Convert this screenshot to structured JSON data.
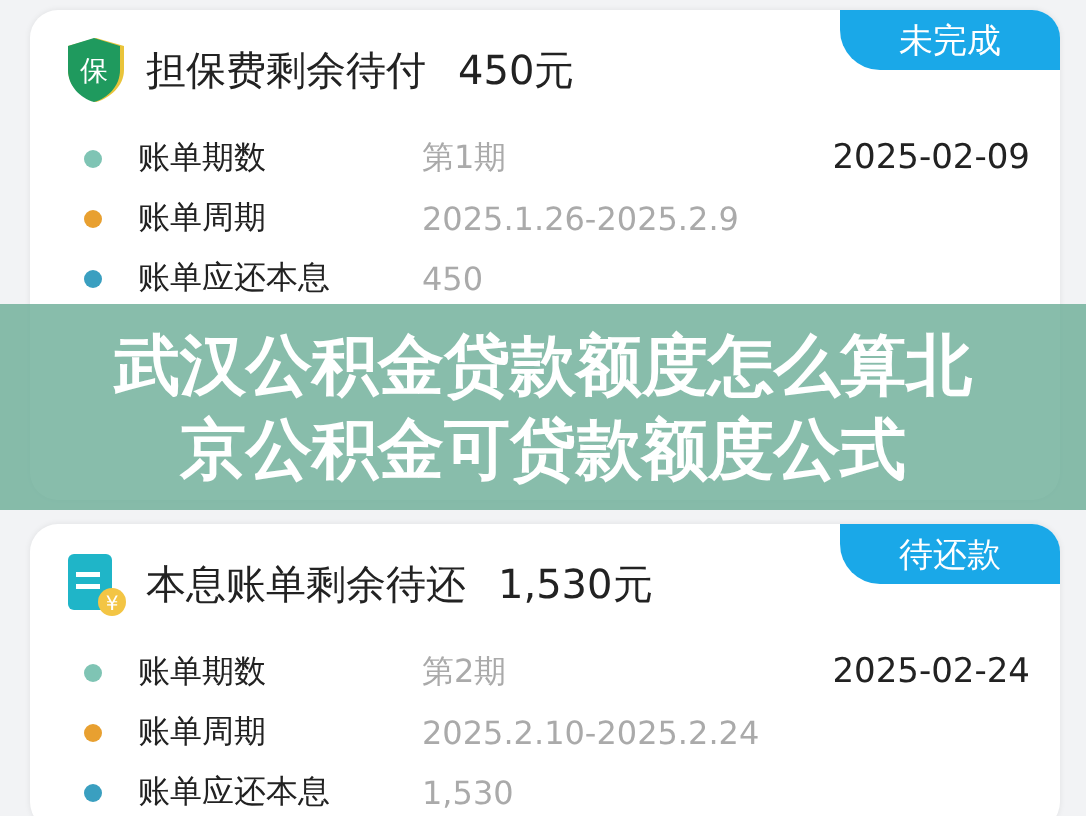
{
  "cards": [
    {
      "kind": "shield",
      "icon_text": "保",
      "title": "担保费剩余待付",
      "amount": "450元",
      "status": "未完成",
      "rows": [
        {
          "label": "账单期数",
          "value": "第1期",
          "date": "2025-02-09",
          "color": "#7fc4b4"
        },
        {
          "label": "账单周期",
          "value": "2025.1.26-2025.2.9",
          "color": "#e8a030"
        },
        {
          "label": "账单应还本息",
          "value": "450",
          "color": "#3a9fc0"
        }
      ]
    },
    {
      "kind": "bill",
      "icon_text": "¥",
      "title": "本息账单剩余待还",
      "amount": "1,530元",
      "status": "待还款",
      "rows": [
        {
          "label": "账单期数",
          "value": "第2期",
          "date": "2025-02-24",
          "color": "#7fc4b4"
        },
        {
          "label": "账单周期",
          "value": "2025.2.10-2025.2.24",
          "color": "#e8a030"
        },
        {
          "label": "账单应还本息",
          "value": "1,530",
          "color": "#3a9fc0"
        }
      ]
    }
  ],
  "banner": {
    "lines": [
      "武汉公积金贷款额度怎么算北",
      "京公积金可贷款额度公式"
    ]
  }
}
